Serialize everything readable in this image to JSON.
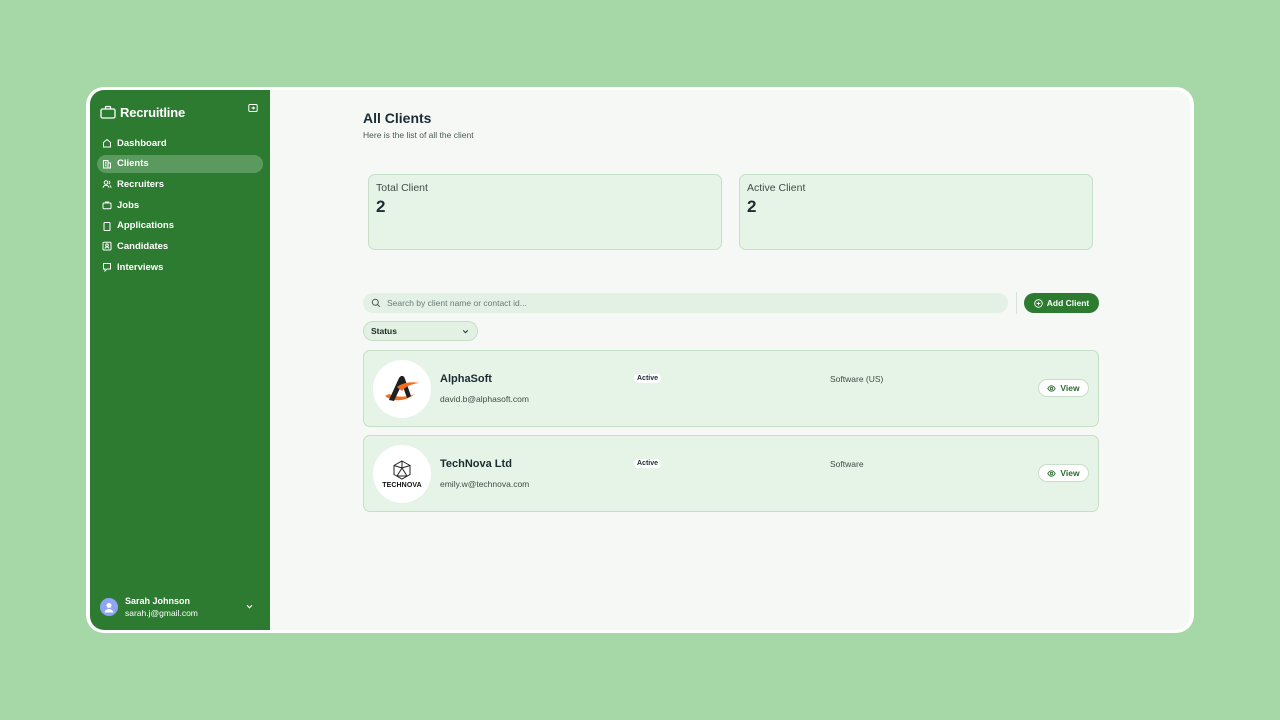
{
  "app": {
    "name": "Recruitline"
  },
  "sidebar": {
    "items": [
      {
        "label": "Dashboard",
        "icon": "home-icon",
        "active": false
      },
      {
        "label": "Clients",
        "icon": "building-icon",
        "active": true
      },
      {
        "label": "Recruiters",
        "icon": "users-icon",
        "active": false
      },
      {
        "label": "Jobs",
        "icon": "briefcase-icon",
        "active": false
      },
      {
        "label": "Applications",
        "icon": "clipboard-icon",
        "active": false
      },
      {
        "label": "Candidates",
        "icon": "id-card-icon",
        "active": false
      },
      {
        "label": "Interviews",
        "icon": "message-icon",
        "active": false
      }
    ]
  },
  "user": {
    "name": "Sarah Johnson",
    "email": "sarah.j@gmail.com"
  },
  "page": {
    "title": "All Clients",
    "subtitle": "Here is the list of all the client"
  },
  "stats": {
    "total": {
      "label": "Total Client",
      "value": "2"
    },
    "active": {
      "label": "Active Client",
      "value": "2"
    }
  },
  "search": {
    "placeholder": "Search by client name or contact id..."
  },
  "toolbar": {
    "add_label": "Add Client"
  },
  "filter": {
    "status_label": "Status"
  },
  "clients": [
    {
      "name": "AlphaSoft",
      "email": "david.b@alphasoft.com",
      "status": "Active",
      "industry": "Software (US)",
      "view_label": "View"
    },
    {
      "name": "TechNova Ltd",
      "email": "emily.w@technova.com",
      "status": "Active",
      "industry": "Software",
      "view_label": "View",
      "logo_text": "TECHNOVA"
    }
  ],
  "colors": {
    "accent": "#2d7a31",
    "background": "#a5d7a7",
    "card": "#e6f4e7"
  }
}
